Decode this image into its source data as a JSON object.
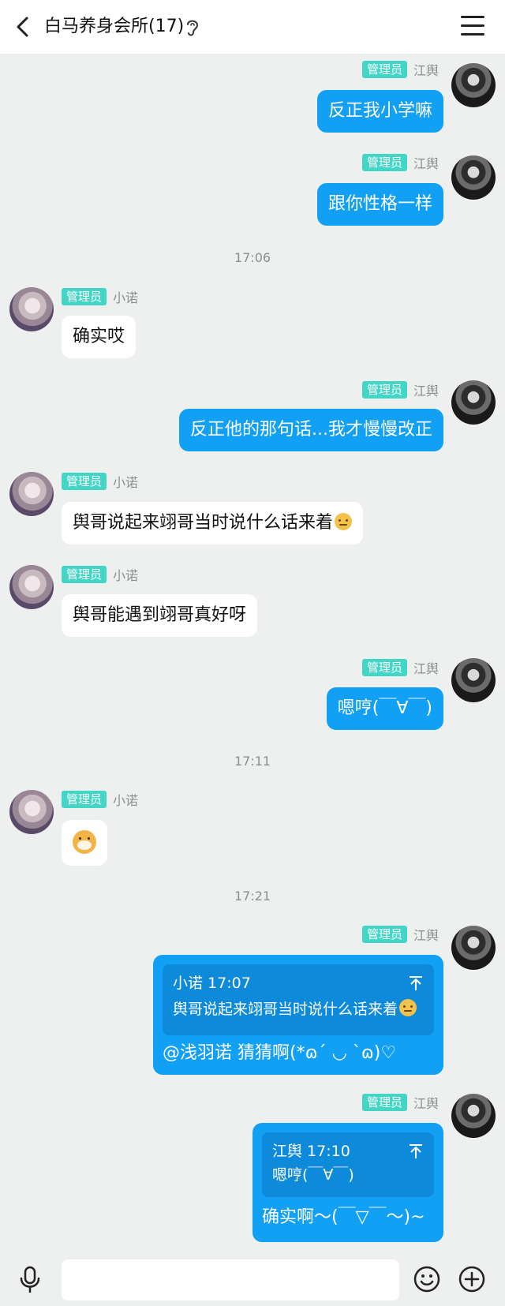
{
  "header": {
    "title": "白马养身会所(17)"
  },
  "labels": {
    "admin": "管理员",
    "jiangyu": "江舆",
    "xiaonuo": "小诺"
  },
  "timestamps": {
    "t1": "17:06",
    "t2": "17:11",
    "t3": "17:21"
  },
  "messages": {
    "m1": "反正我小学嘛",
    "m2": "跟你性格一样",
    "m3": "确实哎",
    "m4": "反正他的那句话...我才慢慢改正",
    "m5": "舆哥说起来翊哥当时说什么话来着",
    "m6": "舆哥能遇到翊哥真好呀",
    "m7": "嗯哼(￣∀￣)",
    "m9": "@浅羽诺 猜猜啊(*ɷ´ ◡ `ɷ)♡",
    "m10": "确实啊～(￣▽￣～)~"
  },
  "quotes": {
    "q1": {
      "head": "小诺 17:07",
      "text": "舆哥说起来翊哥当时说什么话来着"
    },
    "q2": {
      "head": "江舆 17:10",
      "text": "嗯哼(￣∀￣)"
    }
  },
  "icons": {
    "back": "back-arrow-icon",
    "ear": "ear-icon",
    "menu": "menu-icon",
    "mic": "microphone-icon",
    "emoji": "emoji-icon",
    "add": "add-icon",
    "emoji_face": "embarrassed-face-emoji",
    "dog": "dog-sticker"
  },
  "colors": {
    "outgoing": "#12a0f5",
    "badge": "#43d6c7",
    "background": "#eef0ef"
  }
}
